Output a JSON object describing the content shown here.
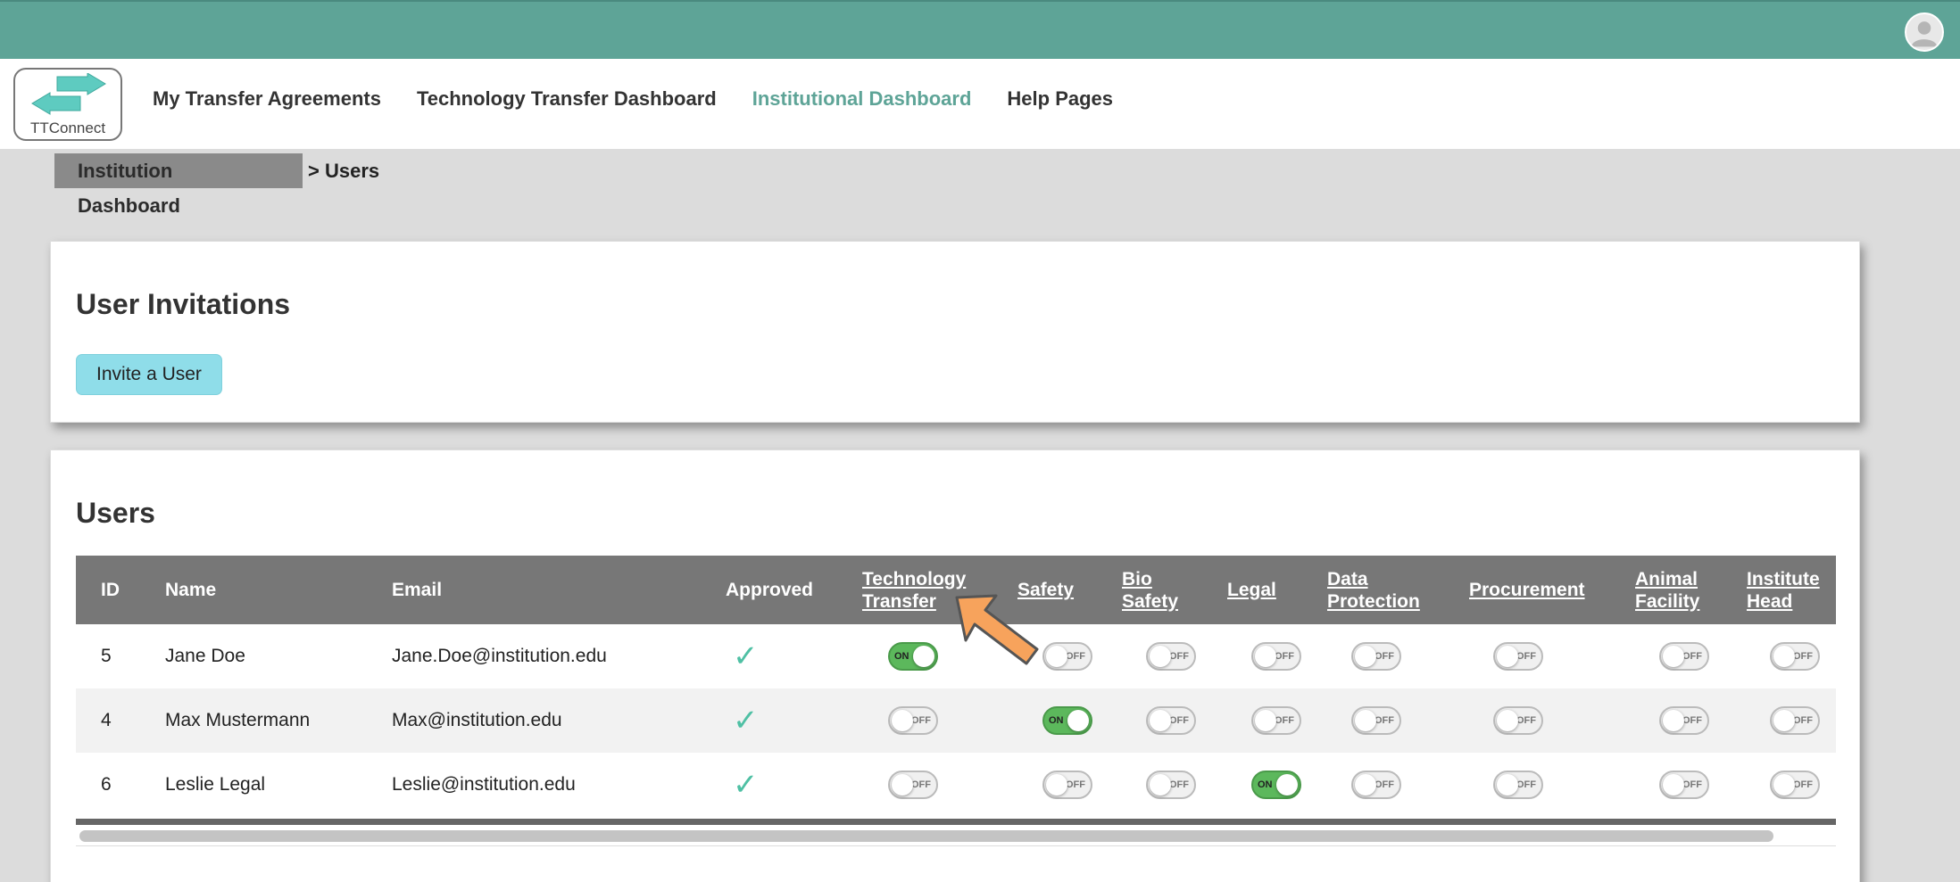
{
  "header": {
    "avatar_icon": "user-avatar-icon"
  },
  "brand": {
    "name": "TTConnect",
    "icon": "transfer-arrows-icon",
    "color": "#5ecbc0"
  },
  "nav": {
    "items": [
      {
        "label": "My Transfer Agreements",
        "active": false
      },
      {
        "label": "Technology Transfer Dashboard",
        "active": false
      },
      {
        "label": "Institutional Dashboard",
        "active": true
      },
      {
        "label": "Help Pages",
        "active": false
      }
    ]
  },
  "breadcrumb": {
    "parent": "Institution Dashboard",
    "current": "> Users"
  },
  "invitations": {
    "title": "User Invitations",
    "invite_button": "Invite a User"
  },
  "users": {
    "title": "Users",
    "columns": {
      "id": "ID",
      "name": "Name",
      "email": "Email",
      "approved": "Approved",
      "tech_transfer": "Technology Transfer",
      "safety": "Safety",
      "bio_safety": "Bio Safety",
      "legal": "Legal",
      "data_protection": "Data Protection",
      "procurement": "Procurement",
      "animal_facility": "Animal Facility",
      "institute_head": "Institute Head"
    },
    "toggle_on_label": "ON",
    "toggle_off_label": "OFF",
    "rows": [
      {
        "id": "5",
        "name": "Jane Doe",
        "email": "Jane.Doe@institution.edu",
        "approved": true,
        "roles": [
          true,
          false,
          false,
          false,
          false,
          false,
          false,
          false
        ]
      },
      {
        "id": "4",
        "name": "Max Mustermann",
        "email": "Max@institution.edu",
        "approved": true,
        "roles": [
          false,
          true,
          false,
          false,
          false,
          false,
          false,
          false
        ]
      },
      {
        "id": "6",
        "name": "Leslie Legal",
        "email": "Leslie@institution.edu",
        "approved": true,
        "roles": [
          false,
          false,
          false,
          true,
          false,
          false,
          false,
          false
        ]
      }
    ]
  },
  "annotation": {
    "icon": "orange-pointer-arrow-icon",
    "color": "#f7a35c"
  }
}
